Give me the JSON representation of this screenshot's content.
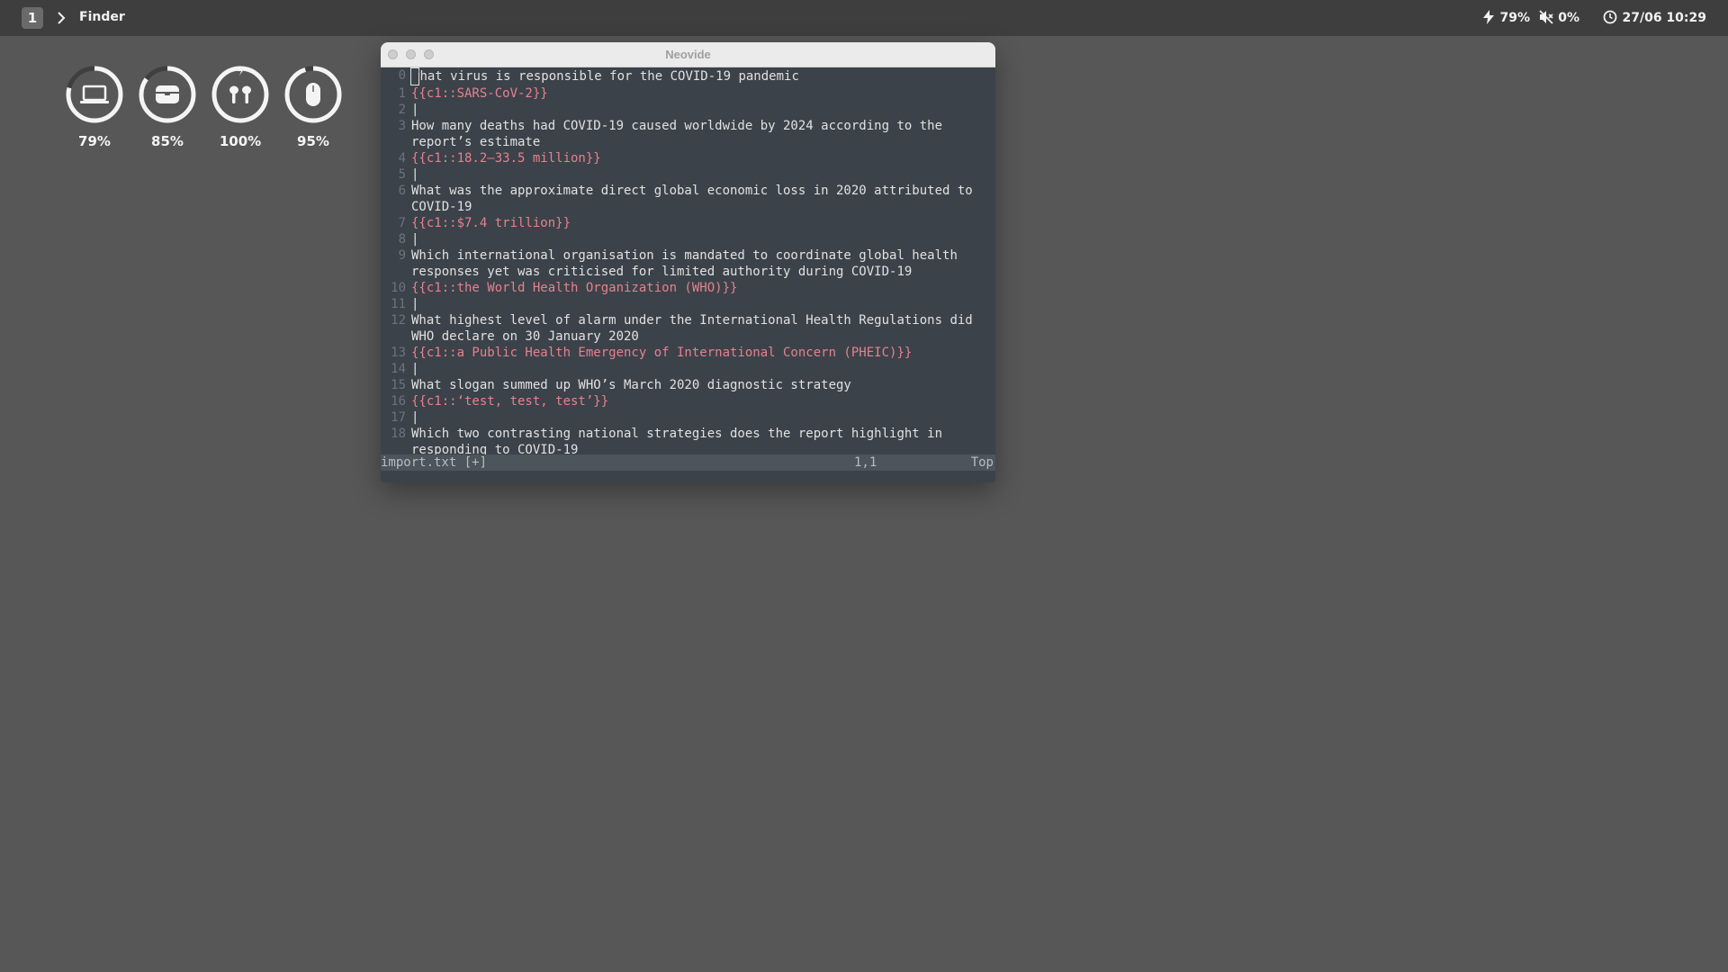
{
  "menubar": {
    "workspace": "1",
    "app_name": "Finder",
    "battery": "79%",
    "volume": "0%",
    "datetime": "27/06 10:29"
  },
  "devices": [
    {
      "icon": "laptop-icon",
      "percent": "79%",
      "level": 0.79
    },
    {
      "icon": "case-icon",
      "percent": "85%",
      "level": 0.85
    },
    {
      "icon": "earbuds-icon",
      "percent": "100%",
      "level": 1.0
    },
    {
      "icon": "mouse-icon",
      "percent": "95%",
      "level": 0.95
    }
  ],
  "window": {
    "title": "Neovide"
  },
  "editor": {
    "lines": [
      {
        "num": "0",
        "text": "hat virus is responsible for the COVID-19 pandemic",
        "cursor_char": "W"
      },
      {
        "num": "1",
        "text": "{{c1::SARS-CoV-2}}",
        "cloze": true
      },
      {
        "num": "2",
        "text": "|"
      },
      {
        "num": "3",
        "text": "How many deaths had COVID-19 caused worldwide by 2024 according to the report’s estimate"
      },
      {
        "num": "4",
        "text": "{{c1::18.2–33.5 million}}",
        "cloze": true
      },
      {
        "num": "5",
        "text": "|"
      },
      {
        "num": "6",
        "text": "What was the approximate direct global economic loss in 2020 attributed to COVID-19"
      },
      {
        "num": "7",
        "text": "{{c1::$7.4 trillion}}",
        "cloze": true
      },
      {
        "num": "8",
        "text": "|"
      },
      {
        "num": "9",
        "text": "Which international organisation is mandated to coordinate global health responses yet was criticised for limited authority during COVID-19"
      },
      {
        "num": "10",
        "text": "{{c1::the World Health Organization (WHO)}}",
        "cloze": true
      },
      {
        "num": "11",
        "text": "|"
      },
      {
        "num": "12",
        "text": "What highest level of alarm under the International Health Regulations did WHO declare on 30 January 2020"
      },
      {
        "num": "13",
        "text": "{{c1::a Public Health Emergency of International Concern (PHEIC)}}",
        "cloze": true
      },
      {
        "num": "14",
        "text": "|"
      },
      {
        "num": "15",
        "text": "What slogan summed up WHO’s March 2020 diagnostic strategy"
      },
      {
        "num": "16",
        "text": "{{c1::‘test, test, test’}}",
        "cloze": true
      },
      {
        "num": "17",
        "text": "|"
      },
      {
        "num": "18",
        "text": "Which two contrasting national strategies does the report highlight in responding to COVID-19"
      }
    ]
  },
  "statusline": {
    "file": "import.txt [+]",
    "position": "1,1",
    "scroll": "Top"
  },
  "colors": {
    "desktop": "#575757",
    "menubar": "#3e3e3e",
    "editor_bg": "#3c4249",
    "cloze_text": "#e5818f",
    "normal_text": "#e1e1e1"
  }
}
